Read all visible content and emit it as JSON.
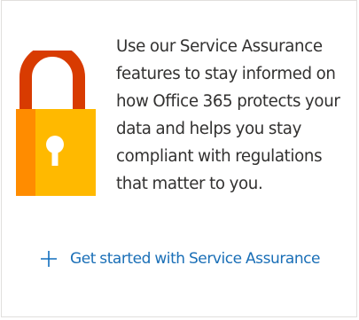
{
  "card": {
    "description": "Use our Service Assurance features to stay informed on how Office 365 protects your data and helps you stay compliant with regulations that matter to you.",
    "action_label": "Get started with Service Assurance"
  },
  "icons": {
    "illustration": "padlock-icon",
    "action": "plus-icon"
  },
  "colors": {
    "shackle": "#d83b01",
    "lock_body": "#ffb900",
    "lock_body_shade": "#ff8c00",
    "keyhole": "#ffffff",
    "link": "#106ebe",
    "text": "#323130",
    "border": "#e1dfdd"
  }
}
